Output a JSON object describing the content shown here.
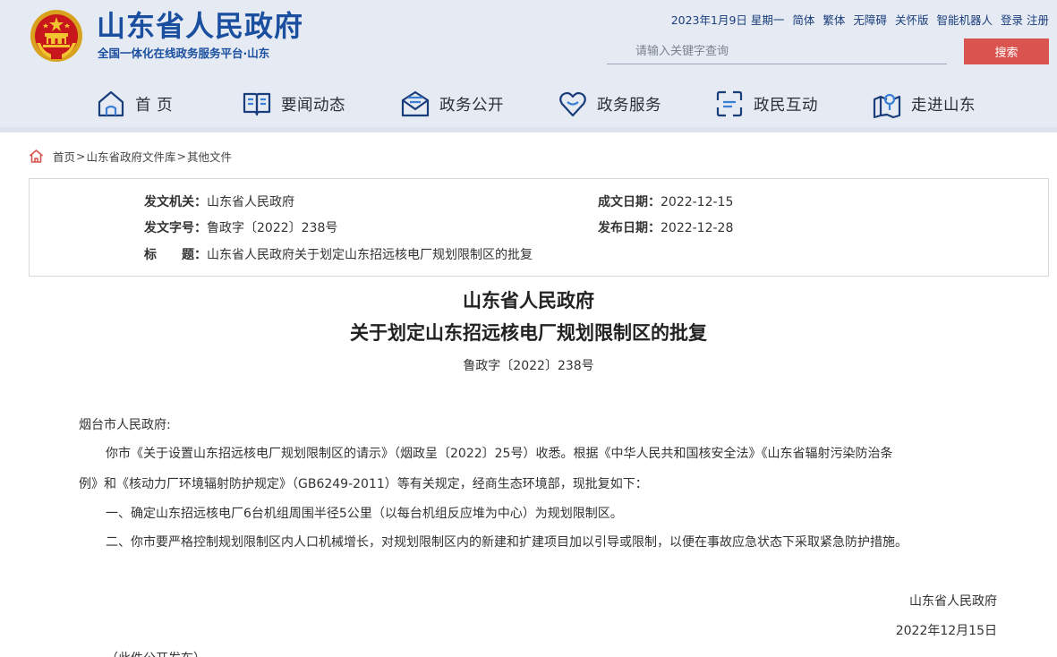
{
  "header": {
    "title": "山东省人民政府",
    "subtitle": "全国一体化在线政务服务平台·山东",
    "date": "2023年1月9日 星期一",
    "links": [
      "简体",
      "繁体",
      "无障碍",
      "关怀版",
      "智能机器人",
      "登录",
      "注册"
    ],
    "search_placeholder": "请输入关键字查询",
    "search_button": "搜索"
  },
  "nav": {
    "items": [
      {
        "label": "首 页",
        "icon": "home-icon"
      },
      {
        "label": "要闻动态",
        "icon": "book-icon"
      },
      {
        "label": "政务公开",
        "icon": "mail-icon"
      },
      {
        "label": "政务服务",
        "icon": "heart-icon"
      },
      {
        "label": "政民互动",
        "icon": "interaction-icon"
      },
      {
        "label": "走进山东",
        "icon": "location-icon"
      }
    ]
  },
  "breadcrumb": {
    "home": "首页",
    "sep": ">",
    "level2": "山东省政府文件库",
    "level3": "其他文件"
  },
  "meta": {
    "issuer_label": "发文机关：",
    "issuer": "山东省人民政府",
    "doc_no_label": "发文字号：",
    "doc_no": "鲁政字〔2022〕238号",
    "title_label": "标　　题：",
    "title": "山东省人民政府关于划定山东招远核电厂规划限制区的批复",
    "written_label": "成文日期：",
    "written": "2022-12-15",
    "published_label": "发布日期：",
    "published": "2022-12-28"
  },
  "document": {
    "title_line1": "山东省人民政府",
    "title_line2": "关于划定山东招远核电厂规划限制区的批复",
    "number": "鲁政字〔2022〕238号",
    "addressee": "烟台市人民政府:",
    "p1_line1": "你市《关于设置山东招远核电厂规划限制区的请示》（烟政呈〔2022〕25号）收悉。根据《中华人民共和国核安全法》《山东省辐射污染防治条",
    "p1_line2": "例》和《核动力厂环境辐射防护规定》（GB6249-2011）等有关规定，经商生态环境部，现批复如下：",
    "p2": "一、确定山东招远核电厂6台机组周围半径5公里（以每台机组反应堆为中心）为规划限制区。",
    "p3": "二、你市要严格控制规划限制区内人口机械增长，对规划限制区内的新建和扩建项目加以引导或限制，以便在事故应急状态下采取紧急防护措施。",
    "signer": "山东省人民政府",
    "sign_date": "2022年12月15日",
    "footnote": "（此件公开发布）"
  },
  "colors": {
    "brand_blue": "#1a4fa0",
    "header_bg": "#e6ebf3",
    "search_button": "#d9534f"
  }
}
